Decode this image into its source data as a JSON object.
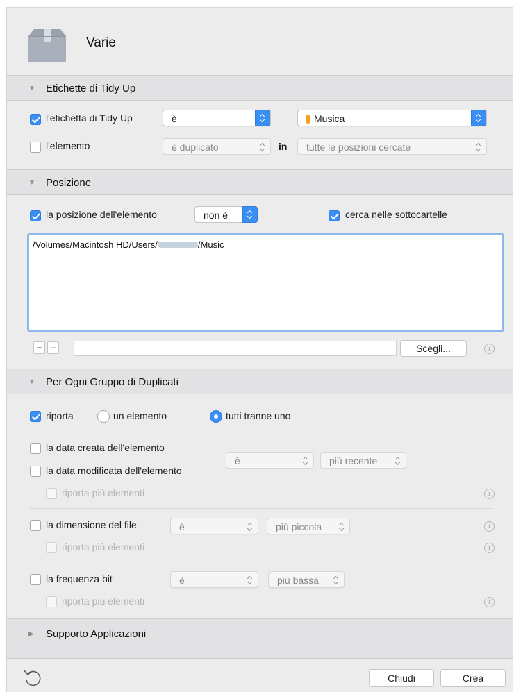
{
  "header": {
    "title": "Varie",
    "icon": "box-icon"
  },
  "sections": {
    "tidyup": {
      "title": "Etichette di Tidy Up"
    },
    "position": {
      "title": "Posizione"
    },
    "duplicates": {
      "title": "Per Ogni Gruppo di Duplicati"
    },
    "support": {
      "title": "Supporto Applicazioni"
    }
  },
  "tidyup": {
    "row1": {
      "checked": true,
      "label": "l'etichetta di Tidy Up",
      "operator": "è",
      "value": "Musica",
      "value_color": "#f7a21e"
    },
    "row2": {
      "checked": false,
      "label": "l'elemento",
      "operator": "è duplicato",
      "in_label": "in",
      "scope": "tutte le posizioni cercate"
    }
  },
  "position": {
    "checked": true,
    "label": "la posizione dell'elemento",
    "operator": "non è",
    "subfolders": {
      "checked": true,
      "label": "cerca nelle sottocartelle"
    },
    "paths": [
      "/Volumes/Macintosh HD/Users/●●●●●●●/Music"
    ],
    "path_prefix": "/Volumes/Macintosh HD/Users/",
    "path_suffix": "/Music",
    "path_input_value": "",
    "choose_label": "Scegli...",
    "remove_label": "−",
    "add_label": "+"
  },
  "duplicates": {
    "report": {
      "checked": true,
      "label": "riporta"
    },
    "options": [
      {
        "label": "un elemento",
        "selected": false
      },
      {
        "label": "tutti tranne uno",
        "selected": true
      }
    ],
    "date_created": {
      "checked": false,
      "label": "la data creata dell'elemento"
    },
    "date_modified": {
      "checked": false,
      "label": "la data modificata dell'elemento"
    },
    "date_operator": "è",
    "date_value": "più recente",
    "date_multi": {
      "checked": false,
      "label": "riporta più elementi"
    },
    "size": {
      "checked": false,
      "label": "la dimensione del file",
      "operator": "è",
      "value": "più piccola"
    },
    "size_multi": {
      "checked": false,
      "label": "riporta più elementi"
    },
    "bitrate": {
      "checked": false,
      "label": "la frequenza bit",
      "operator": "è",
      "value": "più bassa"
    },
    "bitrate_multi": {
      "checked": false,
      "label": "riporta più elementi"
    }
  },
  "footer": {
    "close_label": "Chiudi",
    "create_label": "Crea",
    "reset_icon": "undo-icon"
  },
  "colors": {
    "accent": "#3b8ff2",
    "label_orange": "#f7a21e"
  }
}
